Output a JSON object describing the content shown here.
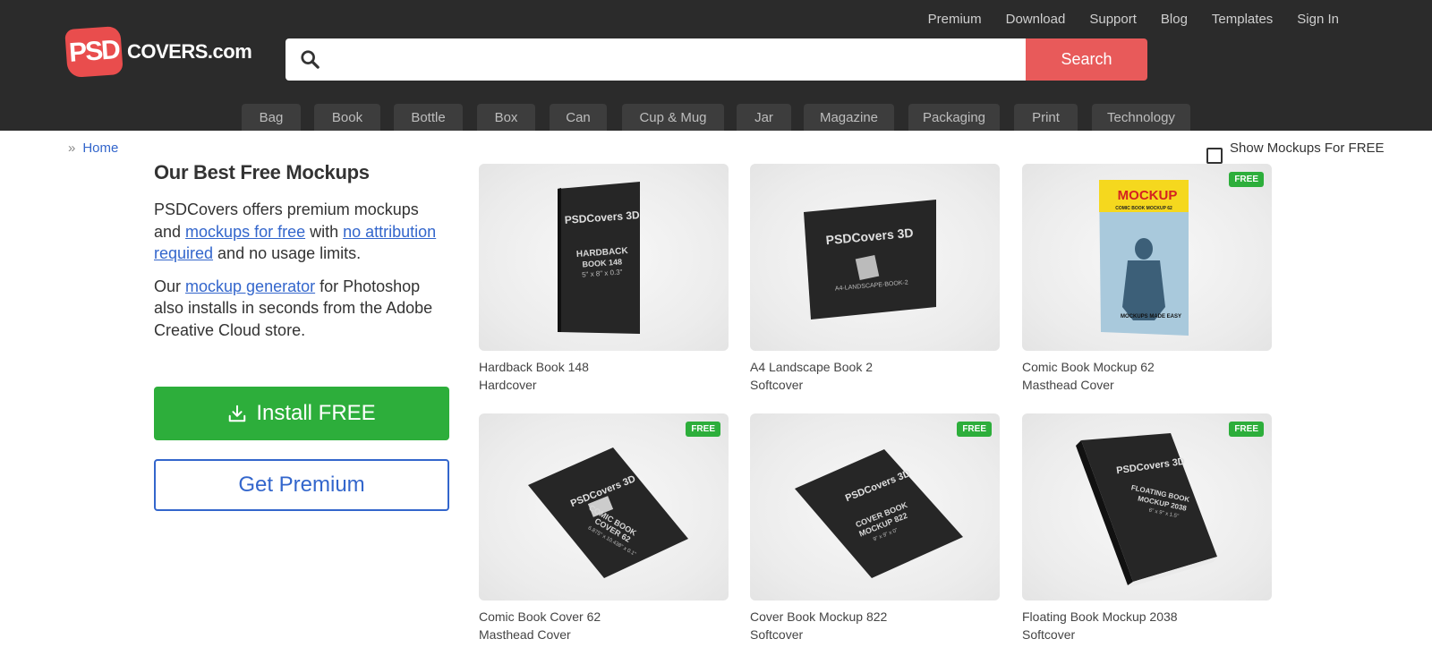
{
  "logo": {
    "badge": "PSD",
    "text": "COVERS.com"
  },
  "topnav": [
    "Premium",
    "Download",
    "Support",
    "Blog",
    "Templates",
    "Sign In"
  ],
  "search": {
    "placeholder": "",
    "button": "Search"
  },
  "categories": [
    "Bag",
    "Book",
    "Bottle",
    "Box",
    "Can",
    "Cup & Mug",
    "Jar",
    "Magazine",
    "Packaging",
    "Print",
    "Technology"
  ],
  "breadcrumb": {
    "separator": "»",
    "home": "Home"
  },
  "free_toggle": {
    "label": "Show Mockups For FREE",
    "checked": false
  },
  "intro": {
    "title": "Our Best Free Mockups",
    "p1_a": "PSDCovers offers premium mockups and ",
    "p1_link1": "mockups for free",
    "p1_b": " with ",
    "p1_link2": "no attribution required",
    "p1_c": " and no usage limits.",
    "p2_a": "Our ",
    "p2_link": "mockup generator",
    "p2_b": " for Photoshop also installs in seconds from the Adobe Creative Cloud store."
  },
  "buttons": {
    "install": "Install FREE",
    "premium": "Get Premium"
  },
  "mockups": [
    {
      "title": "Hardback Book 148",
      "subtitle": "Hardcover",
      "free": false,
      "cover_text": [
        "PSDCovers 3D",
        "HARDBACK",
        "BOOK 148",
        "5\" x 8\" x 0.3\""
      ]
    },
    {
      "title": "A4 Landscape Book 2",
      "subtitle": "Softcover",
      "free": false,
      "cover_text": [
        "PSDCovers 3D",
        "A4-LANDSCAPE-BOOK-2"
      ]
    },
    {
      "title": "Comic Book Mockup 62",
      "subtitle": "Masthead Cover",
      "free": true,
      "cover_text": [
        "MOCKUP",
        "COMIC BOOK MOCKUP 62",
        "MOCKUPS MADE EASY"
      ]
    },
    {
      "title": "Comic Book Cover 62",
      "subtitle": "Masthead Cover",
      "free": true,
      "cover_text": [
        "PSDCovers 3D",
        "COMIC BOOK",
        "COVER 62",
        "6.875\" x 10.438\" x 0.1\""
      ]
    },
    {
      "title": "Cover Book Mockup 822",
      "subtitle": "Softcover",
      "free": true,
      "cover_text": [
        "PSDCovers 3D",
        "COVER BOOK",
        "MOCKUP 822",
        "9\" x 9\" x 0\""
      ]
    },
    {
      "title": "Floating Book Mockup 2038",
      "subtitle": "Softcover",
      "free": true,
      "cover_text": [
        "PSDCovers 3D",
        "FLOATING BOOK",
        "MOCKUP 2038",
        "6\" x 9\" x 1.5\""
      ]
    }
  ],
  "badge_label": "FREE",
  "colors": {
    "header_bg": "#2b2b2b",
    "accent_red": "#e85a5a",
    "green": "#2dae3b",
    "link_blue": "#3366cc"
  }
}
